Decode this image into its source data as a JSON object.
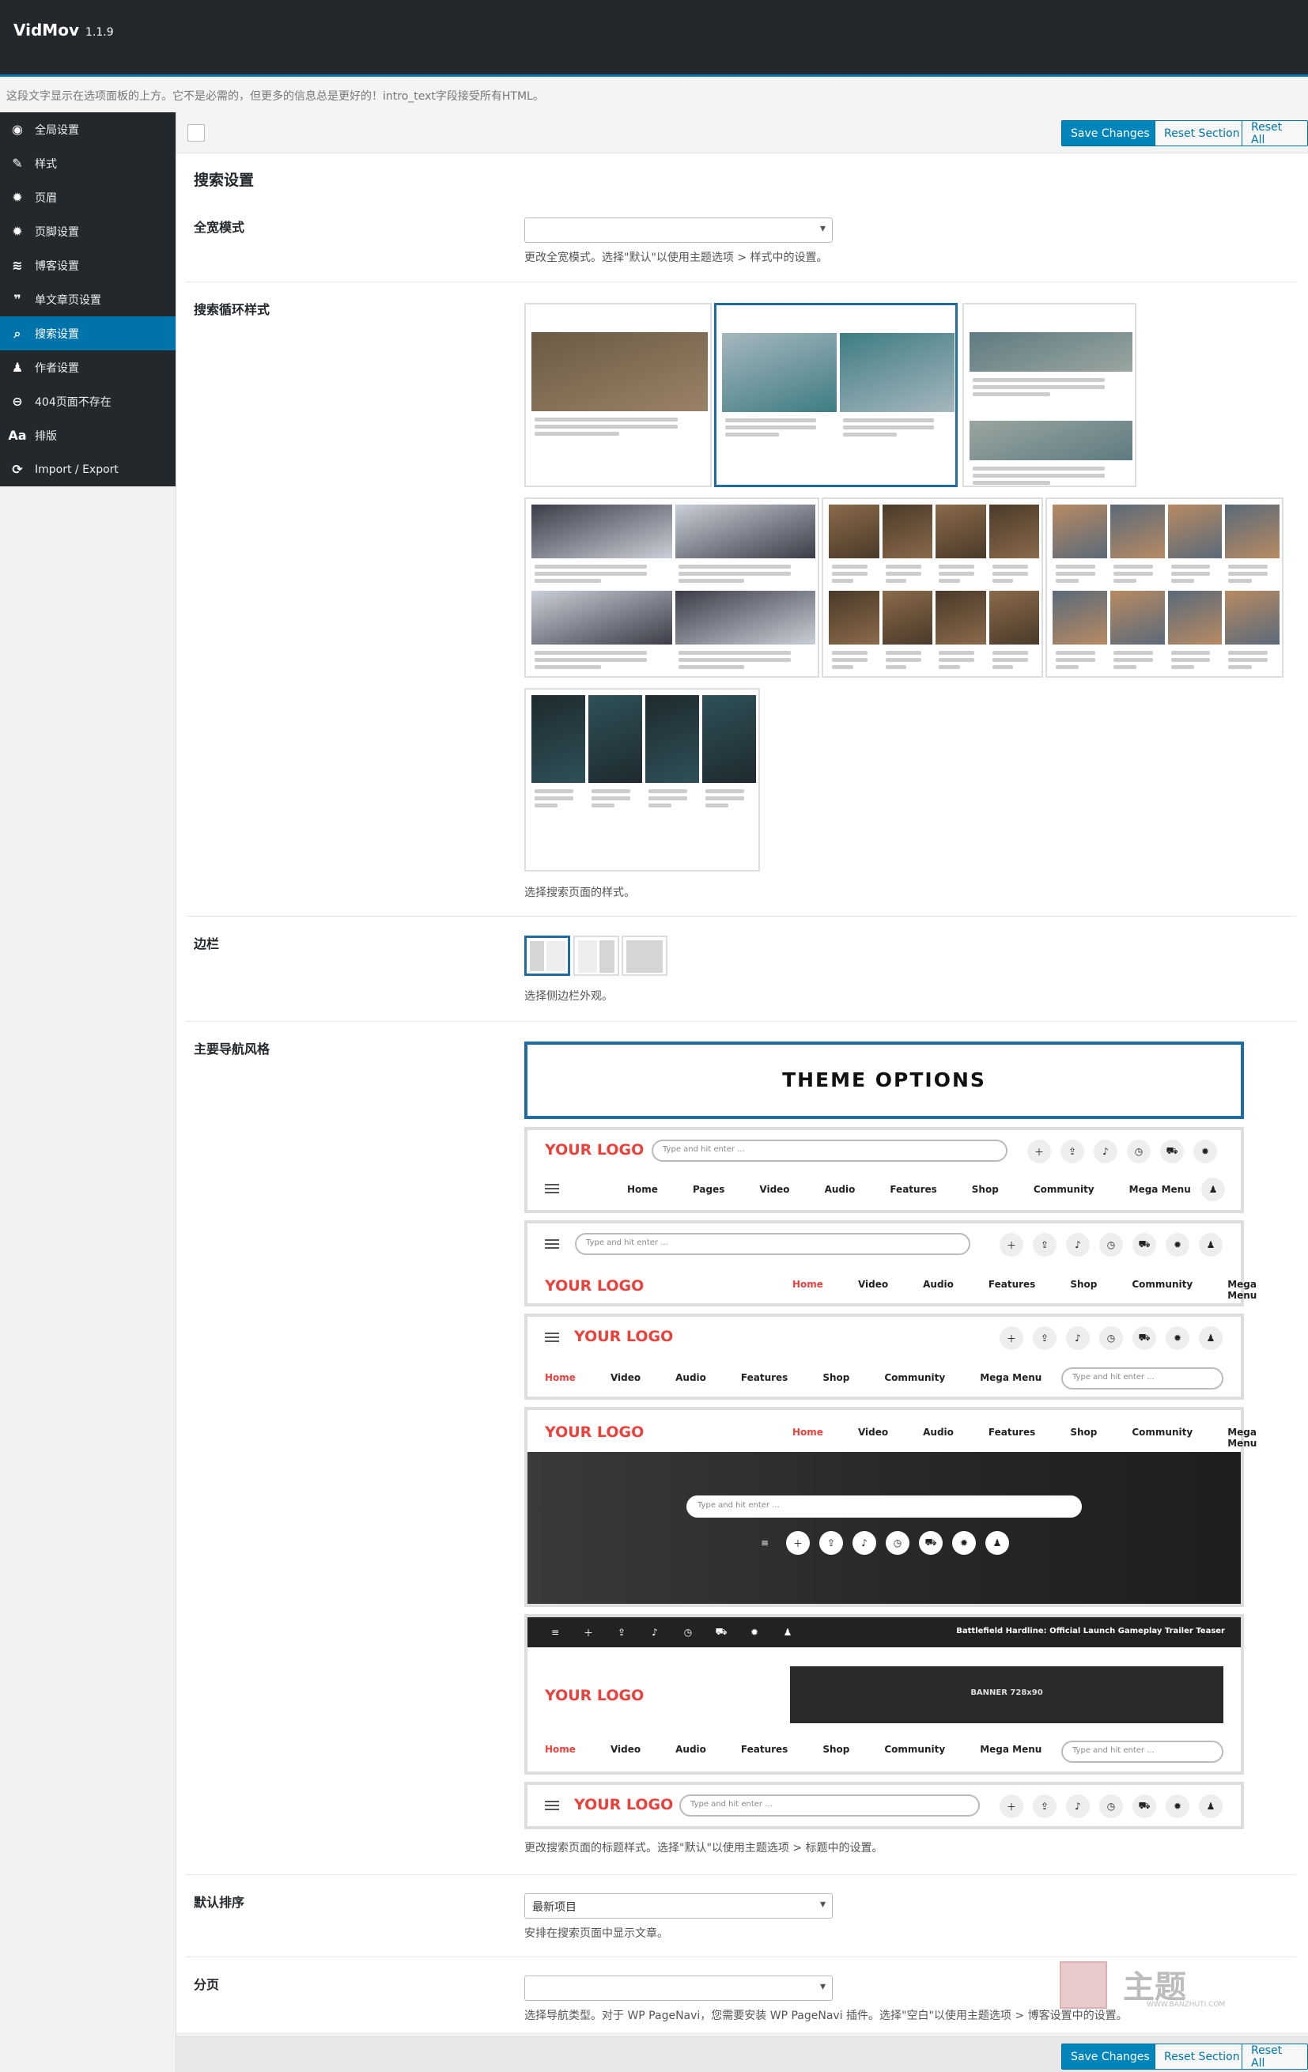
{
  "header": {
    "title": "VidMov",
    "version": "1.1.9"
  },
  "intro": "这段文字显示在选项面板的上方。它不是必需的，但更多的信息总是更好的！intro_text字段接受所有HTML。",
  "sidebar": {
    "items": [
      {
        "label": "全局设置",
        "icon": "globe-icon",
        "glyph": "◉"
      },
      {
        "label": "样式",
        "icon": "brush-icon",
        "glyph": "✎"
      },
      {
        "label": "页眉",
        "icon": "gear-icon",
        "glyph": "✹"
      },
      {
        "label": "页脚设置",
        "icon": "gear-icon",
        "glyph": "✹"
      },
      {
        "label": "博客设置",
        "icon": "rss-icon",
        "glyph": "≋"
      },
      {
        "label": "单文章页设置",
        "icon": "quote-icon",
        "glyph": "❞"
      },
      {
        "label": "搜索设置",
        "icon": "search-icon",
        "glyph": "⌕"
      },
      {
        "label": "作者设置",
        "icon": "user-icon",
        "glyph": "♟"
      },
      {
        "label": "404页面不存在",
        "icon": "minus-circle-icon",
        "glyph": "⊖"
      },
      {
        "label": "排版",
        "icon": "typography-icon",
        "glyph": "Aa"
      },
      {
        "label": "Import / Export",
        "icon": "refresh-icon",
        "glyph": "⟳"
      }
    ],
    "active_index": 6
  },
  "toolbar": {
    "save": "Save Changes",
    "reset_section": "Reset Section",
    "reset_all": "Reset All"
  },
  "section_title": "搜索设置",
  "fields": {
    "fullwidth": {
      "label": "全宽模式",
      "value": "",
      "desc": "更改全宽模式。选择\"默认\"以使用主题选项 > 样式中的设置。"
    },
    "loop": {
      "label": "搜索循环样式",
      "desc": "选择搜索页面的样式。"
    },
    "sidebar": {
      "label": "边栏",
      "desc": "选择侧边栏外观。"
    },
    "nav": {
      "label": "主要导航风格",
      "desc": "更改搜索页面的标题样式。选择\"默认\"以使用主题选项 > 标题中的设置。"
    },
    "order": {
      "label": "默认排序",
      "value": "最新项目",
      "desc": "安排在搜索页面中显示文章。"
    },
    "pagination": {
      "label": "分页",
      "value": "",
      "desc": "选择导航类型。对于 WP PageNavi，您需要安装 WP PageNavi 插件。选择\"空白\"以使用主题选项 > 博客设置中的设置。"
    }
  },
  "nav_preview": {
    "banner_title": "THEME OPTIONS",
    "logo": "YOUR LOGO",
    "search_placeholder": "Type and hit enter ...",
    "menu_a": [
      "Home",
      "Pages",
      "Video",
      "Audio",
      "Features",
      "Shop",
      "Community",
      "Mega Menu"
    ],
    "menu_b": [
      "Home",
      "Video",
      "Audio",
      "Features",
      "Shop",
      "Community",
      "Mega Menu"
    ],
    "ticker": "Battlefield Hardline: Official Launch Gameplay Trailer Teaser",
    "banner_ad": "BANNER 728x90"
  },
  "watermark": {
    "text": "主题",
    "url": "WWW.BANZHUTI.COM"
  },
  "colors": {
    "accent": "#0073aa",
    "logo": "#e8423d",
    "sidebar_bg": "#23282d"
  }
}
